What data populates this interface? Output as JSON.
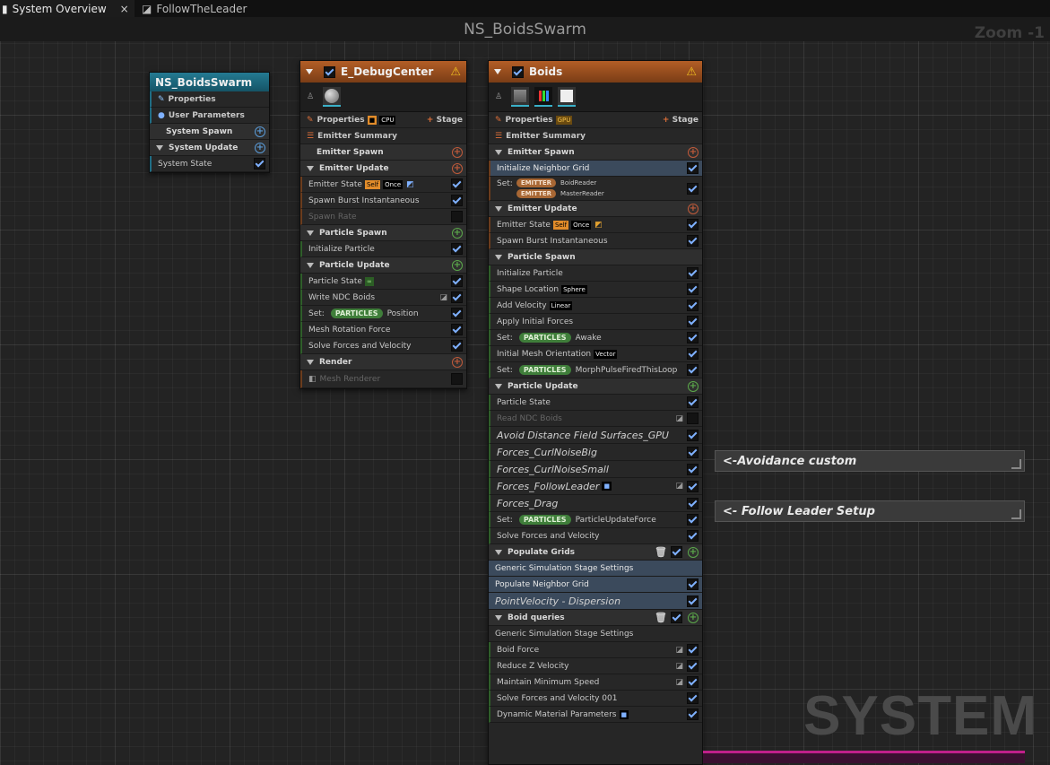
{
  "tabs": [
    {
      "label": "System Overview",
      "close": "×"
    },
    {
      "label": "FollowTheLeader"
    }
  ],
  "system_name": "NS_BoidsSwarm",
  "zoom": "Zoom -1",
  "watermark": "SYSTEM",
  "system_node": {
    "title": "NS_BoidsSwarm",
    "rows": [
      "Properties",
      "User Parameters",
      "System Spawn",
      "System Update",
      "System State"
    ]
  },
  "debug_node": {
    "title": "E_DebugCenter",
    "properties": "Properties",
    "cpu": "CPU",
    "stage": "Stage",
    "emitter_summary": "Emitter Summary",
    "emitter_spawn": "Emitter Spawn",
    "emitter_update": "Emitter Update",
    "emitter_state": "Emitter State",
    "self": "Self",
    "once": "Once",
    "spawn_burst": "Spawn Burst Instantaneous",
    "spawn_rate": "Spawn Rate",
    "particle_spawn": "Particle Spawn",
    "initialize_particle": "Initialize Particle",
    "particle_update": "Particle Update",
    "particle_state": "Particle State",
    "particle_state_tag": "∞",
    "write_ndc": "Write NDC Boids",
    "set": "Set:",
    "particles": "PARTICLES",
    "position": "Position",
    "mesh_rotation": "Mesh Rotation Force",
    "solve_forces": "Solve Forces and Velocity",
    "render": "Render",
    "mesh_renderer": "Mesh Renderer"
  },
  "boids_node": {
    "title": "Boids",
    "properties": "Properties",
    "gpu": "GPU",
    "stage": "Stage",
    "emitter_summary": "Emitter Summary",
    "emitter_spawn": "Emitter Spawn",
    "init_neighbor": "Initialize Neighbor Grid",
    "set": "Set:",
    "emitter": "EMITTER",
    "boid_reader": "BoidReader",
    "master_reader": "MasterReader",
    "emitter_update": "Emitter Update",
    "emitter_state": "Emitter State",
    "self": "Self",
    "once": "Once",
    "spawn_burst": "Spawn Burst Instantaneous",
    "particle_spawn": "Particle Spawn",
    "initialize_particle": "Initialize Particle",
    "shape_location": "Shape Location",
    "sphere": "Sphere",
    "add_velocity": "Add Velocity",
    "linear": "Linear",
    "apply_forces": "Apply Initial Forces",
    "particles": "PARTICLES",
    "awake": "Awake",
    "initial_mesh": "Initial Mesh Orientation",
    "vector": "Vector",
    "morph": "MorphPulseFiredThisLoop",
    "particle_update": "Particle Update",
    "particle_state": "Particle State",
    "read_ndc": "Read NDC Boids",
    "avoid": "Avoid Distance Field Surfaces_GPU",
    "curl_big": "Forces_CurlNoiseBig",
    "curl_small": "Forces_CurlNoiseSmall",
    "follow_leader": "Forces_FollowLeader",
    "drag": "Forces_Drag",
    "update_force": "ParticleUpdateForce",
    "solve_forces": "Solve Forces and Velocity",
    "populate_grids": "Populate Grids",
    "generic_settings": "Generic Simulation Stage Settings",
    "populate_neighbor": "Populate Neighbor Grid",
    "point_velocity": "PointVelocity - Dispersion",
    "boid_queries": "Boid queries",
    "generic_settings2": "Generic Simulation Stage Settings",
    "boid_force": "Boid Force",
    "reduce_z": "Reduce Z Velocity",
    "maintain_speed": "Maintain Minimum Speed",
    "solve_forces_001": "Solve Forces and Velocity 001",
    "dynamic_material": "Dynamic Material Parameters"
  },
  "comments": [
    "<-Avoidance custom",
    "<- Follow Leader Setup"
  ],
  "colors": {
    "accent_orange": "#c26a2a",
    "system_teal": "#1c6b83",
    "check_blue": "#7fb1ff"
  }
}
